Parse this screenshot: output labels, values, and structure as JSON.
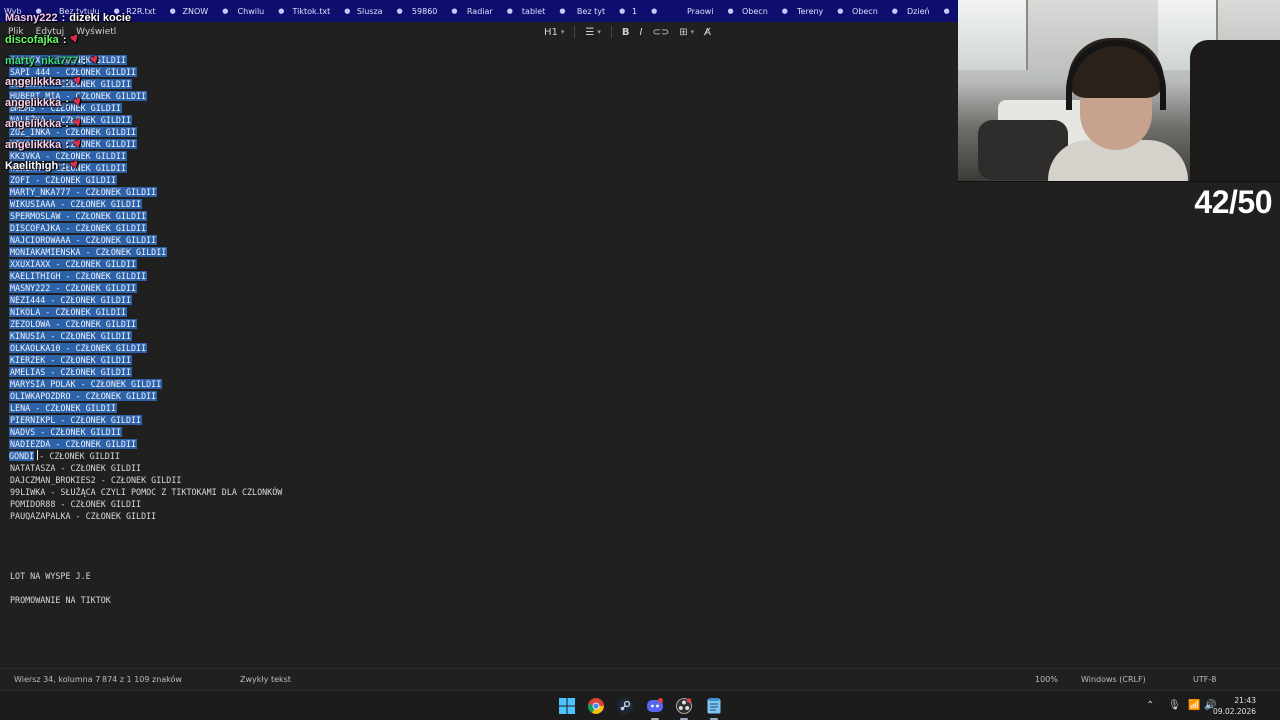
{
  "tabs": [
    {
      "label": "Wyb"
    },
    {
      "label": "Bez tytułu"
    },
    {
      "label": "R2R.txt"
    },
    {
      "label": "ZNOW"
    },
    {
      "label": "Chwilu"
    },
    {
      "label": "Tiktok.txt"
    },
    {
      "label": "Slusza"
    },
    {
      "label": "59860"
    },
    {
      "label": "Radiar"
    },
    {
      "label": "tablet"
    },
    {
      "label": "Bez tyt"
    },
    {
      "label": "1"
    },
    {
      "label": "Praowi"
    },
    {
      "label": "Obecn"
    },
    {
      "label": "Tereny"
    },
    {
      "label": "Obecn"
    },
    {
      "label": "Dzień"
    }
  ],
  "menu": {
    "file": "Plik",
    "edit": "Edytuj",
    "view": "Wyświetl"
  },
  "toolbar": {
    "heading": "H1",
    "bold": "B",
    "italic": "I"
  },
  "document": {
    "lines": [
      {
        "text": "JAQUEX - CZŁONEK GILDII",
        "selected": true
      },
      {
        "text": "SAPI 444 - CZŁONEK GILDII",
        "selected": true
      },
      {
        "text": "BOŻENKA - CZŁONEK GILDII",
        "selected": true
      },
      {
        "text": "HUBERT MIA - CZŁONEK GILDII",
        "selected": true
      },
      {
        "text": "BMBMS - CZŁONEK GILDII",
        "selected": true
      },
      {
        "text": "NALEŻKA - CZŁONEK GILDII",
        "selected": true
      },
      {
        "text": "ZOZ_INKA - CZŁONEK GILDII",
        "selected": true
      },
      {
        "text": "KIKA.ZKA - CZŁONEK GILDII",
        "selected": true
      },
      {
        "text": "KK3VKA - CZŁONEK GILDII",
        "selected": true
      },
      {
        "text": "WEWIKA - CZŁONEK GILDII",
        "selected": true
      },
      {
        "text": "ZOFI - CZŁONEK GILDII",
        "selected": true
      },
      {
        "text": "MARTY_NKA777 - CZŁONEK GILDII",
        "selected": true
      },
      {
        "text": "WIKUSIAAA - CZŁONEK GILDII",
        "selected": true
      },
      {
        "text": "SPERMOSLAW - CZŁONEK GILDII",
        "selected": true
      },
      {
        "text": "DISCOFAJKA - CZŁONEK GILDII",
        "selected": true
      },
      {
        "text": "NAJCIOROWAAA - CZŁONEK GILDII",
        "selected": true
      },
      {
        "text": "MONIAKAMIENSKA - CZŁONEK GILDII",
        "selected": true
      },
      {
        "text": "XXUXIAXX - CZŁONEK GILDII",
        "selected": true
      },
      {
        "text": "KAELITHIGH - CZŁONEK GILDII",
        "selected": true
      },
      {
        "text": "MASNY222 - CZŁONEK GILDII",
        "selected": true
      },
      {
        "text": "NEZI444 - CZŁONEK GILDII",
        "selected": true
      },
      {
        "text": "NIKOLA - CZŁONEK GILDII",
        "selected": true
      },
      {
        "text": "ZEZOLOWA - CZŁONEK GILDII",
        "selected": true
      },
      {
        "text": "KINUSIA - CZŁONEK GILDII",
        "selected": true
      },
      {
        "text": "OLKAOLKA10 - CZŁONEK GILDII",
        "selected": true
      },
      {
        "text": "KIERZEK - CZŁONEK GILDII",
        "selected": true
      },
      {
        "text": "AMELIAS - CZŁONEK GILDII",
        "selected": true
      },
      {
        "text": "MARYSIA POLAK - CZŁONEK GILDII",
        "selected": true
      },
      {
        "text": "OLIWKAPOZDRO - CZŁONEK GILDII",
        "selected": true
      },
      {
        "text": "LENA - CZŁONEK GILDII",
        "selected": true
      },
      {
        "text": "PIERNIKPL - CZŁONEK GILDII",
        "selected": true
      },
      {
        "text": "NADVS - CZŁONEK GILDII",
        "selected": true
      },
      {
        "text": "NADIEZDA - CZŁONEK GILDII",
        "selected": true
      },
      {
        "text": "GONDI - CZŁONEK GILDII",
        "selected": false,
        "selected_prefix": "GONDI",
        "rest": " - CZŁONEK GILDII"
      },
      {
        "text": "NATATASZA - CZŁONEK GILDII",
        "selected": false
      },
      {
        "text": "DAJCZMAN_BROKIES2 - CZŁONEK GILDII",
        "selected": false
      },
      {
        "text": "99LIWKA - SŁUŻĄCA CZYLI POMOC Z TIKTOKAMI DLA CZLONKÓW",
        "selected": false
      },
      {
        "text": "POMIDOR88 - CZŁONEK GILDII",
        "selected": false
      },
      {
        "text": "PAUQAZAPALKA - CZŁONEK GILDII",
        "selected": false
      },
      {
        "text": "",
        "selected": false
      },
      {
        "text": "",
        "selected": false
      },
      {
        "text": "",
        "selected": false
      },
      {
        "text": "",
        "selected": false
      },
      {
        "text": "LOT NA WYSPE J.E",
        "selected": false
      },
      {
        "text": "",
        "selected": false
      },
      {
        "text": "PROMOWANIE NA TIKTOK",
        "selected": false
      }
    ]
  },
  "chat": [
    {
      "user": "Masny222",
      "color": "#f2c7ff",
      "text": "dizeki kocie",
      "heart": false
    },
    {
      "user": "discofajka",
      "color": "#66ff66",
      "text": "",
      "heart": true
    },
    {
      "user": "marty_nka777",
      "color": "#3ddc84",
      "text": "",
      "heart": true
    },
    {
      "user": "angelikkka",
      "color": "#ffd1e8",
      "text": "",
      "heart": true
    },
    {
      "user": "angelikkka",
      "color": "#ffd1e8",
      "text": "",
      "heart": true
    },
    {
      "user": "angelikkka",
      "color": "#ffd1e8",
      "text": "",
      "heart": true
    },
    {
      "user": "angelikkka",
      "color": "#ffd1e8",
      "text": "",
      "heart": true
    },
    {
      "user": "Kaelithigh",
      "color": "#ffffff",
      "text": "",
      "heart": true
    }
  ],
  "counter": "42/50",
  "status": {
    "position": "Wiersz 34, kolumna 7",
    "chars": "874 z 1 109 znaków",
    "format": "Zwykły tekst",
    "zoom": "100%",
    "line_endings": "Windows (CRLF)",
    "encoding": "UTF-8"
  },
  "clock": {
    "time": "21:43",
    "date": "09.02.2026"
  },
  "colors": {
    "selection": "#2e62a8",
    "tabbar": "#0e0e6e",
    "editor_bg": "#202020"
  },
  "icons": [
    "windows-start-icon",
    "chrome-icon",
    "steam-icon",
    "discord-icon",
    "obs-icon",
    "notepad-icon"
  ]
}
